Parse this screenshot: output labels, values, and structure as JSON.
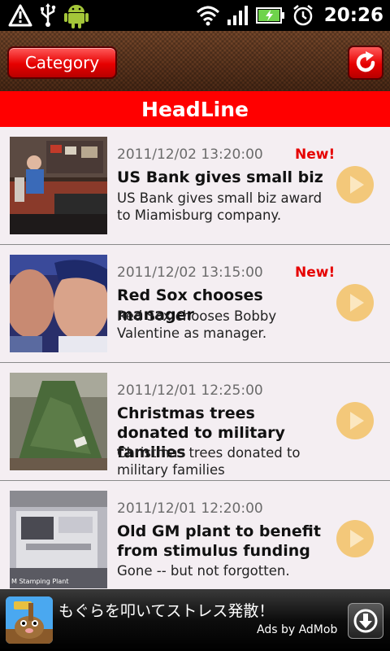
{
  "status_bar": {
    "time": "20:26",
    "icons": [
      "warning-icon",
      "usb-icon",
      "android-icon",
      "wifi-icon",
      "signal-icon",
      "battery-icon",
      "alarm-icon"
    ]
  },
  "toolbar": {
    "category_label": "Category",
    "refresh_icon": "refresh-icon"
  },
  "headline": {
    "title": "HeadLine"
  },
  "news": [
    {
      "date": "2011/12/02 13:20:00",
      "badge": "New!",
      "title": "US Bank gives small biz",
      "description": "US Bank gives small biz award to Miamisburg company."
    },
    {
      "date": "2011/12/02 13:15:00",
      "badge": "New!",
      "title": "Red Sox chooses manager",
      "description": "Red Sox chooses Bobby Valentine as manager."
    },
    {
      "date": "2011/12/01 12:25:00",
      "badge": "",
      "title": "Christmas trees donated to military families",
      "description": "Christmas trees donated to military families"
    },
    {
      "date": "2011/12/01 12:20:00",
      "badge": "",
      "title": "Old GM plant to benefit from stimulus funding",
      "description": "Gone -- but not forgotten.",
      "thumbnail_caption": "M Stamping Plant"
    }
  ],
  "ad": {
    "text": "もぐらを叩いてストレス発散！",
    "credit": "Ads by AdMob"
  },
  "colors": {
    "accent_red": "#ff0000",
    "new_badge": "#e60000",
    "play_button": "#f3c87a",
    "list_background": "#f4eef2"
  }
}
